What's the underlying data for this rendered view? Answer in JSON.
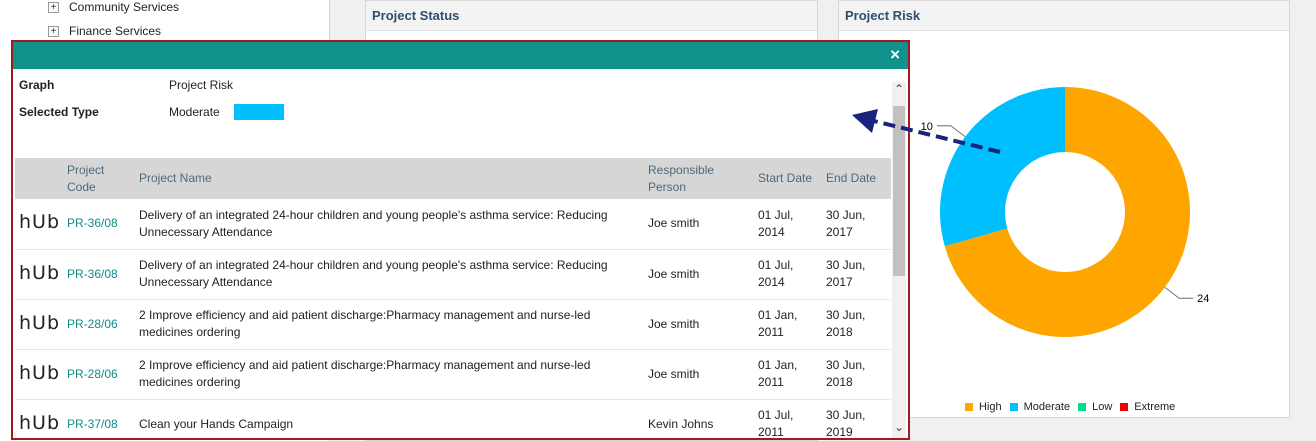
{
  "tree": {
    "items": [
      {
        "expander": "+",
        "label": "Community Services"
      },
      {
        "expander": "+",
        "label": "Finance Services"
      }
    ]
  },
  "cards": {
    "status_title": "Project Status",
    "risk_title": "Project Risk"
  },
  "chart_data": {
    "type": "pie",
    "title": "Project Risk",
    "donut": true,
    "categories": [
      "High",
      "Moderate",
      "Low",
      "Extreme"
    ],
    "values": [
      24,
      10,
      0,
      0
    ],
    "data_labels": [
      "24",
      "10"
    ],
    "colors": [
      "#ffa500",
      "#00bfff",
      "#00e08a",
      "#ee0000"
    ],
    "legend_placement": "bottom"
  },
  "modal": {
    "close_icon": "×",
    "graph_label": "Graph",
    "graph_value": "Project Risk",
    "type_label": "Selected Type",
    "type_value": "Moderate",
    "type_color": "#00bfff",
    "columns": [
      "",
      "Project Code",
      "Project Name",
      "Responsible Person",
      "Start Date",
      "End Date"
    ],
    "rows": [
      {
        "logo": "hUb",
        "code": "PR-36/08",
        "name": "Delivery of an integrated 24-hour children and young people's asthma service: Reducing Unnecessary Attendance",
        "person": "Joe smith",
        "start": "01 Jul, 2014",
        "end": "30 Jun, 2017"
      },
      {
        "logo": "hUb",
        "code": "PR-36/08",
        "name": "Delivery of an integrated 24-hour children and young people's asthma service: Reducing Unnecessary Attendance",
        "person": "Joe smith",
        "start": "01 Jul, 2014",
        "end": "30 Jun, 2017"
      },
      {
        "logo": "hUb",
        "code": "PR-28/06",
        "name": "2 Improve efficiency and aid patient discharge:Pharmacy management and nurse-led medicines ordering",
        "person": "Joe smith",
        "start": "01 Jan, 2011",
        "end": "30 Jun, 2018"
      },
      {
        "logo": "hUb",
        "code": "PR-28/06",
        "name": "2 Improve efficiency and aid patient discharge:Pharmacy management and nurse-led medicines ordering",
        "person": "Joe smith",
        "start": "01 Jan, 2011",
        "end": "30 Jun, 2018"
      },
      {
        "logo": "hUb",
        "code": "PR-37/08",
        "name": "Clean your Hands Campaign",
        "person": "Kevin Johns",
        "start": "01 Jul, 2011",
        "end": "30 Jun, 2019"
      }
    ],
    "scroll_up_icon": "chevron-up-icon",
    "scroll_down_icon": "chevron-down-icon"
  }
}
